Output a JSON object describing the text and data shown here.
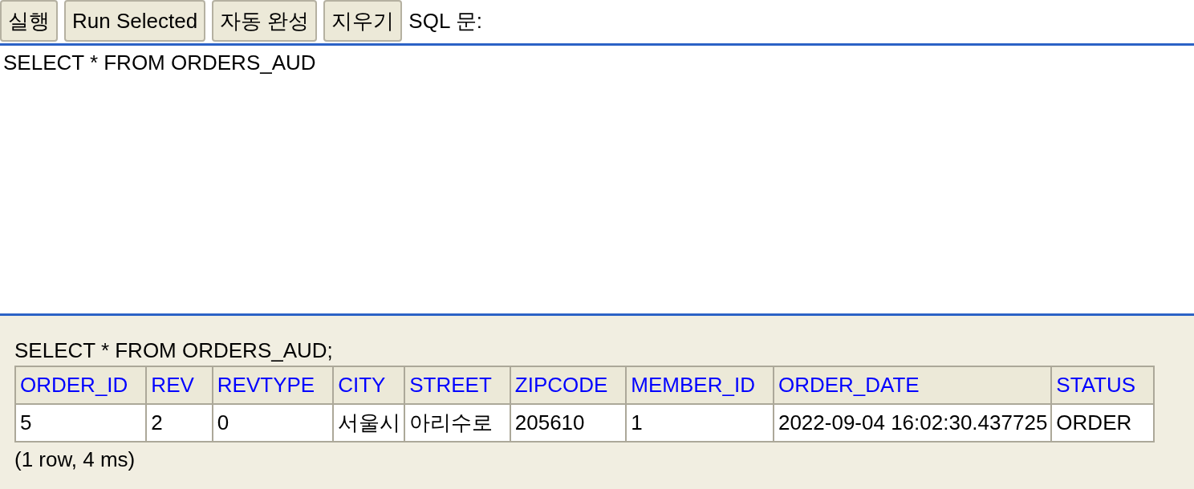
{
  "toolbar": {
    "buttons": [
      "실행",
      "Run Selected",
      "자동 완성",
      "지우기"
    ],
    "label": "SQL 문:"
  },
  "editor": {
    "value": "SELECT * FROM ORDERS_AUD"
  },
  "result": {
    "statement": "SELECT * FROM ORDERS_AUD;",
    "table": {
      "columns": [
        "ORDER_ID",
        "REV",
        "REVTYPE",
        "CITY",
        "STREET",
        "ZIPCODE",
        "MEMBER_ID",
        "ORDER_DATE",
        "STATUS"
      ],
      "rows": [
        [
          "5",
          "2",
          "0",
          "서울시",
          "아리수로",
          "205610",
          "1",
          "2022-09-04 16:02:30.437725",
          "ORDER"
        ]
      ]
    },
    "summary": "(1 row, 4 ms)"
  }
}
